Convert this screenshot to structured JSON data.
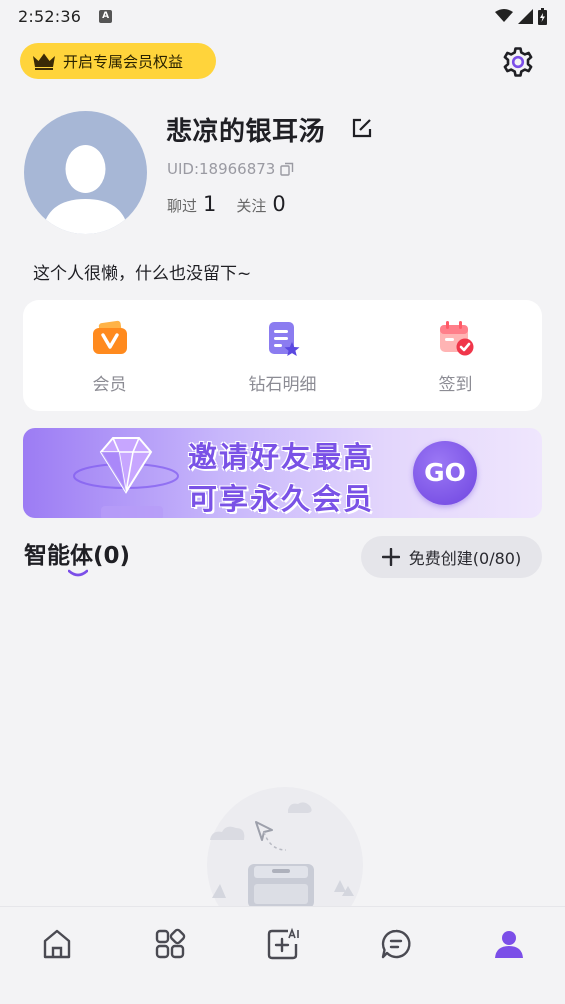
{
  "status_bar": {
    "time": "2:52:36",
    "notification_badge": "A"
  },
  "header": {
    "vip_label": "开启专属会员权益"
  },
  "profile": {
    "nickname": "悲凉的银耳汤",
    "uid": "UID:18966873",
    "chat_label": "聊过",
    "chat_count": "1",
    "follow_label": "关注",
    "follow_count": "0",
    "bio": "这个人很懒，什么也没留下~"
  },
  "quick_actions": [
    {
      "label": "会员",
      "icon": "vip-icon"
    },
    {
      "label": "钻石明细",
      "icon": "diamond-detail-icon"
    },
    {
      "label": "签到",
      "icon": "checkin-calendar-icon"
    }
  ],
  "banner": {
    "line1": "邀请好友最高",
    "line2": "可享永久会员",
    "cta": "GO"
  },
  "agents": {
    "title": "智能体(0)",
    "create_label": "免费创建(0/80)"
  },
  "tab_bar": [
    {
      "icon": "home-icon",
      "active": false
    },
    {
      "icon": "apps-grid-icon",
      "active": false
    },
    {
      "icon": "ai-create-icon",
      "active": false
    },
    {
      "icon": "chat-icon",
      "active": false
    },
    {
      "icon": "profile-icon",
      "active": true
    }
  ],
  "colors": {
    "accent": "#7b4ee8",
    "vip_yellow": "#ffd43b",
    "background": "#f3f3f5"
  }
}
